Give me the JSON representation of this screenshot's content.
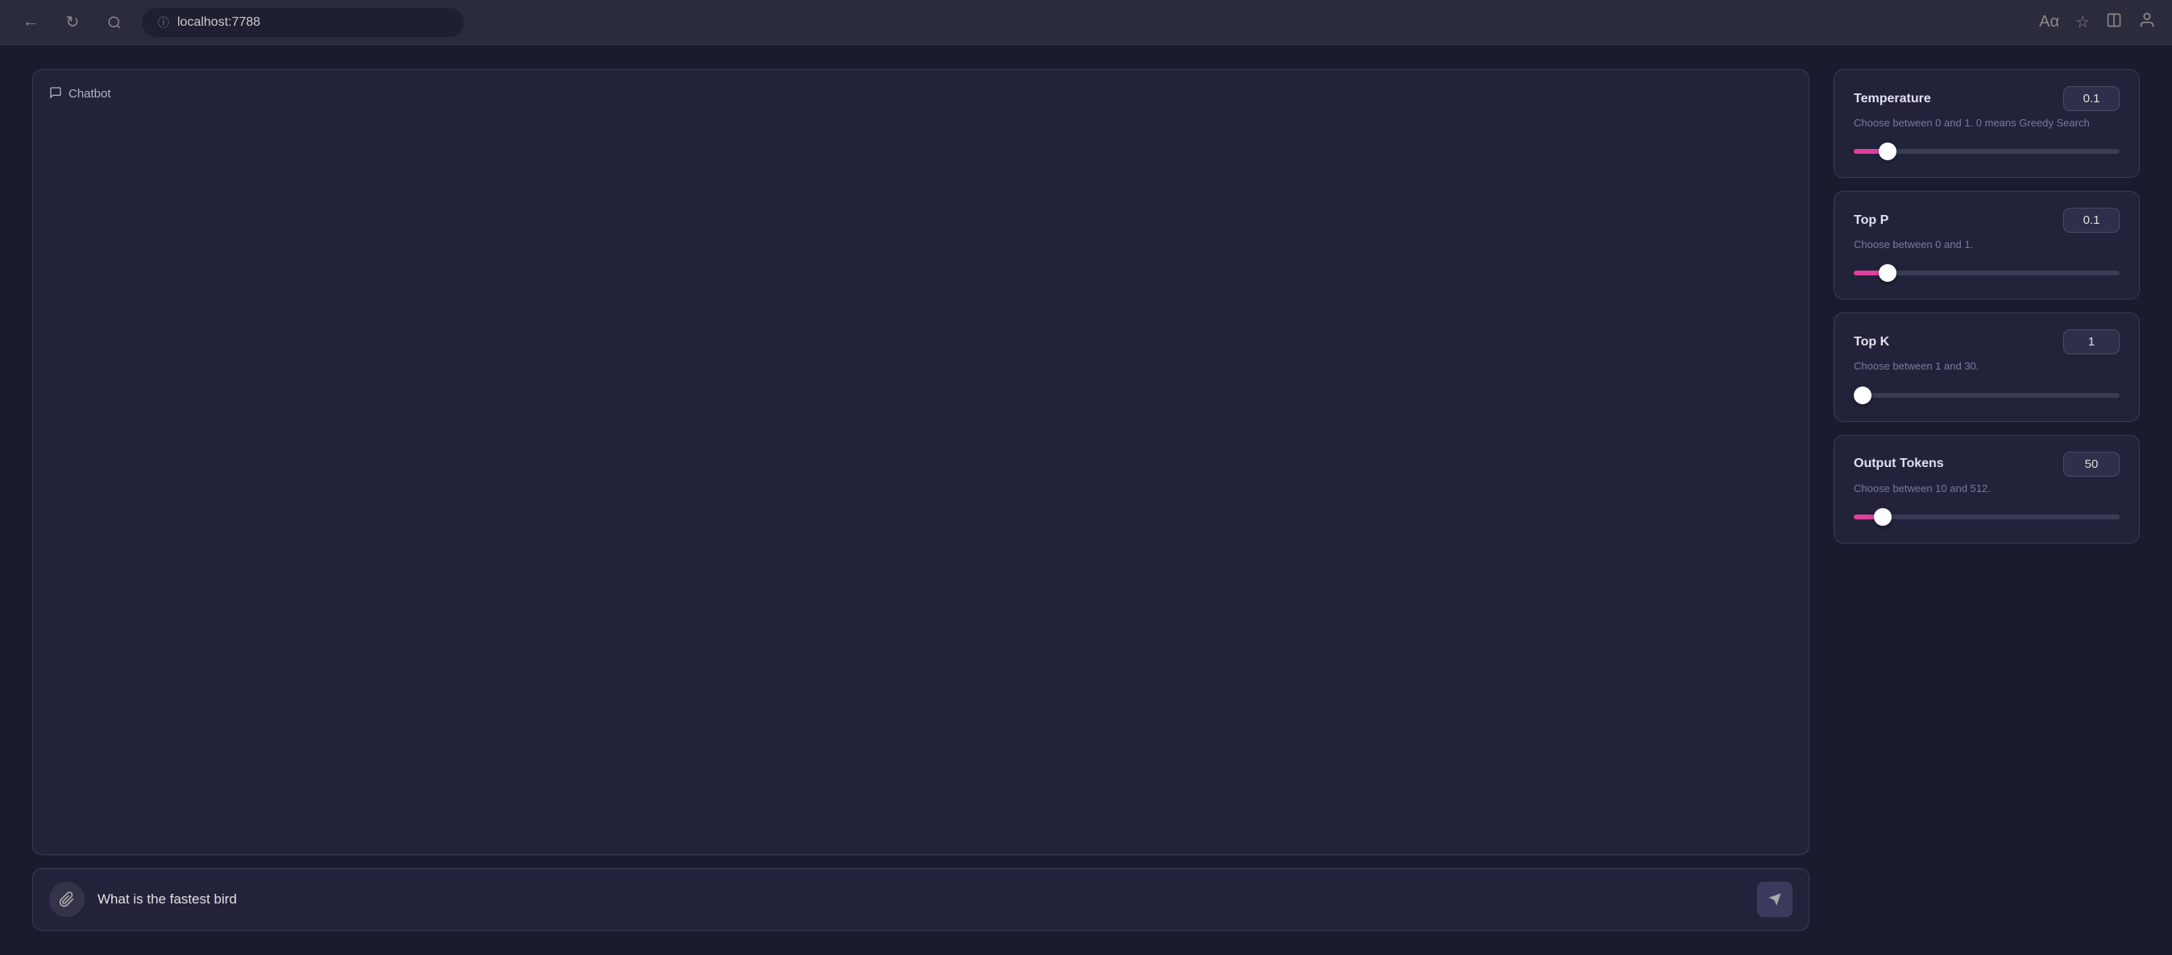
{
  "browser": {
    "url": "localhost:7788",
    "back_label": "←",
    "reload_label": "↻",
    "search_label": "🔍"
  },
  "chatbot": {
    "title": "Chatbot",
    "chat_icon": "💬",
    "input_placeholder": "What is the fastest bird",
    "input_value": "What is the fastest bird "
  },
  "settings": {
    "temperature": {
      "label": "Temperature",
      "value": "0.1",
      "description": "Choose between 0 and 1. 0 means Greedy Search",
      "min": 0,
      "max": 1,
      "step": 0.1,
      "percent": 10
    },
    "top_p": {
      "label": "Top P",
      "value": "0.1",
      "description": "Choose between 0 and 1.",
      "min": 0,
      "max": 1,
      "step": 0.1,
      "percent": 10
    },
    "top_k": {
      "label": "Top K",
      "value": "1",
      "description": "Choose between 1 and 30.",
      "min": 1,
      "max": 30,
      "step": 1,
      "percent": 0
    },
    "output_tokens": {
      "label": "Output Tokens",
      "value": "50",
      "description": "Choose between 10 and 512.",
      "min": 10,
      "max": 512,
      "step": 1,
      "percent": 8
    }
  },
  "icons": {
    "attach": "📎",
    "send": "➤",
    "info": "ⓘ",
    "back": "←",
    "forward": "→",
    "reload": "↻",
    "search": "🔍",
    "translate": "Aα",
    "bookmark": "☆",
    "split": "⊡",
    "profile": "👤"
  }
}
